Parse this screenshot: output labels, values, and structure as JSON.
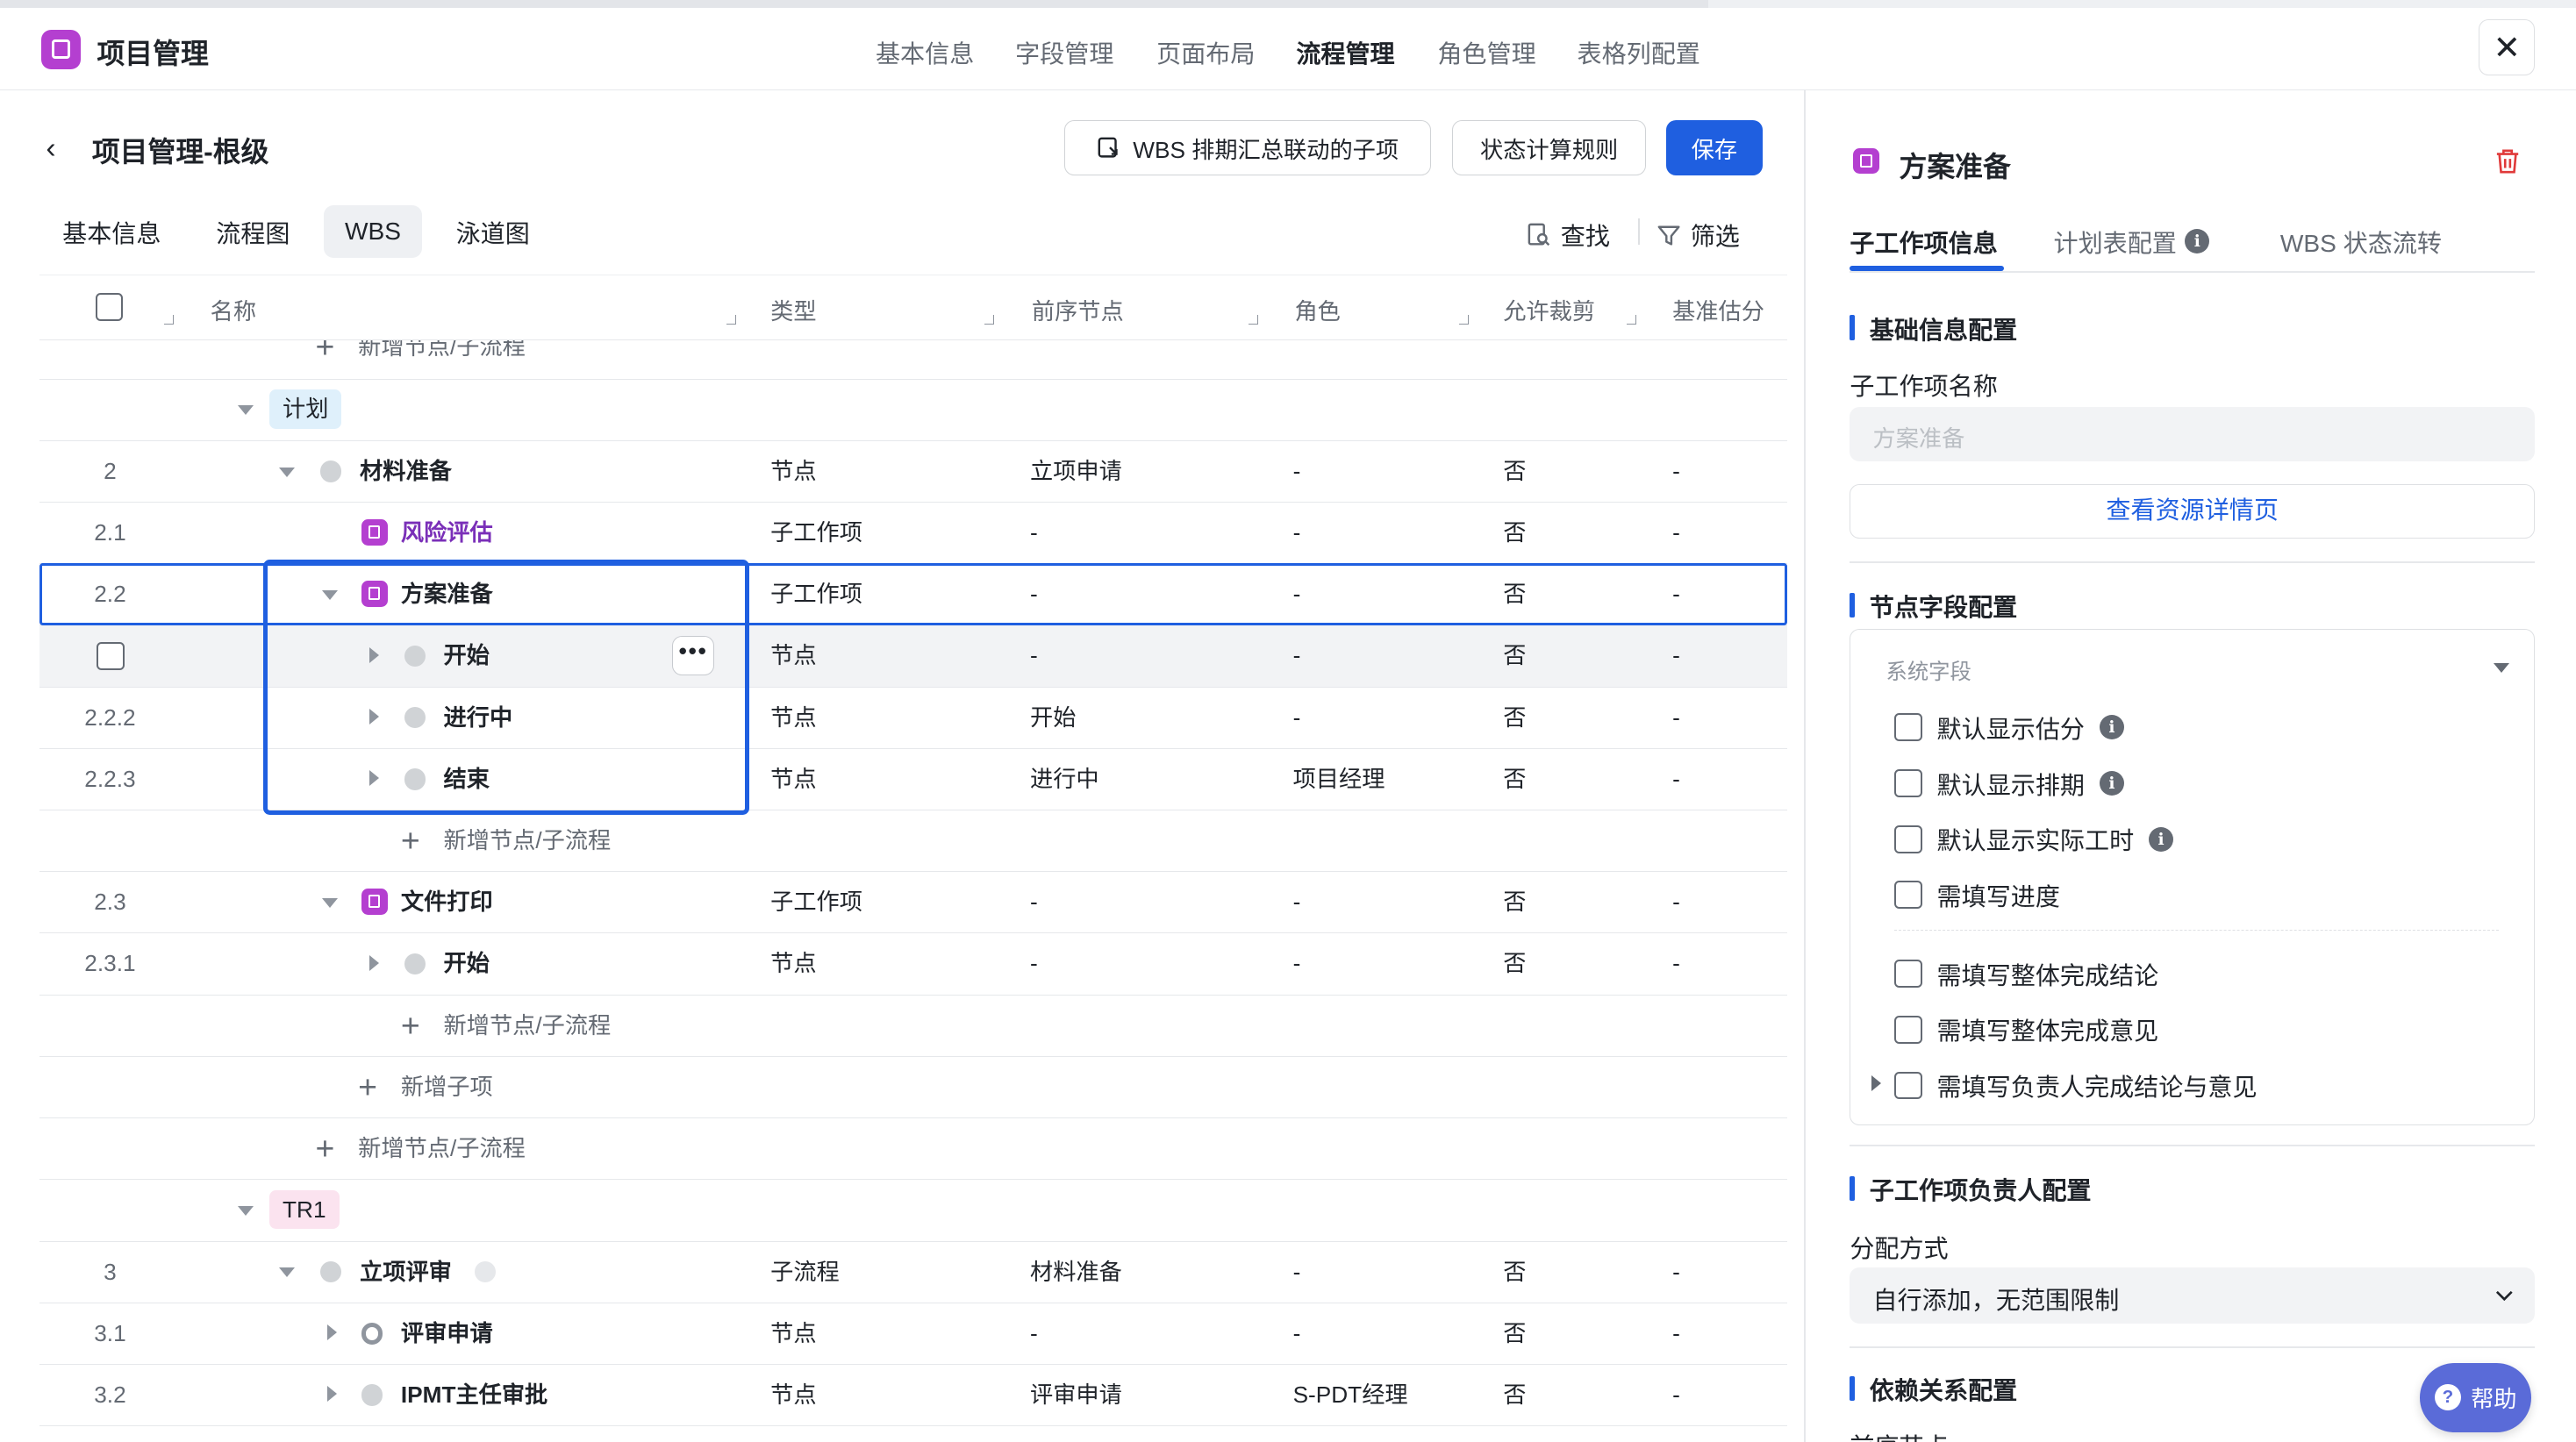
{
  "app": {
    "title": "项目管理",
    "nav": [
      "基本信息",
      "字段管理",
      "页面布局",
      "流程管理",
      "角色管理",
      "表格列配置"
    ],
    "active_nav": "流程管理",
    "close": "✕"
  },
  "subheader": {
    "back": "‹",
    "title": "项目管理-根级",
    "buttons": {
      "wbs_link": "WBS 排期汇总联动的子项",
      "status_rules": "状态计算规则",
      "save": "保存"
    }
  },
  "view_tabs": [
    "基本信息",
    "流程图",
    "WBS",
    "泳道图"
  ],
  "active_view_tab": "WBS",
  "toolbar": {
    "find": "查找",
    "filter": "筛选"
  },
  "table": {
    "columns": [
      "名称",
      "类型",
      "前序节点",
      "角色",
      "允许裁剪",
      "基准估分"
    ],
    "partial_add": "新增节点/子流程",
    "group_plan": "计划",
    "group_tr1": "TR1",
    "rows": [
      {
        "num": "2",
        "name": "材料准备",
        "type": "节点",
        "prev": "立项申请",
        "role": "-",
        "cut": "否",
        "est": "-"
      },
      {
        "num": "2.1",
        "name": "风险评估",
        "type": "子工作项",
        "prev": "-",
        "role": "-",
        "cut": "否",
        "est": "-"
      },
      {
        "num": "2.2",
        "name": "方案准备",
        "type": "子工作项",
        "prev": "-",
        "role": "-",
        "cut": "否",
        "est": "-"
      },
      {
        "num": "",
        "name": "开始",
        "type": "节点",
        "prev": "-",
        "role": "-",
        "cut": "否",
        "est": "-"
      },
      {
        "num": "2.2.2",
        "name": "进行中",
        "type": "节点",
        "prev": "开始",
        "role": "-",
        "cut": "否",
        "est": "-"
      },
      {
        "num": "2.2.3",
        "name": "结束",
        "type": "节点",
        "prev": "进行中",
        "role": "项目经理",
        "cut": "否",
        "est": "-"
      },
      {
        "num": "2.3",
        "name": "文件打印",
        "type": "子工作项",
        "prev": "-",
        "role": "-",
        "cut": "否",
        "est": "-"
      },
      {
        "num": "2.3.1",
        "name": "开始",
        "type": "节点",
        "prev": "-",
        "role": "-",
        "cut": "否",
        "est": "-"
      },
      {
        "num": "3",
        "name": "立项评审",
        "type": "子流程",
        "prev": "材料准备",
        "role": "-",
        "cut": "否",
        "est": "-"
      },
      {
        "num": "3.1",
        "name": "评审申请",
        "type": "节点",
        "prev": "-",
        "role": "-",
        "cut": "否",
        "est": "-"
      },
      {
        "num": "3.2",
        "name": "IPMT主任审批",
        "type": "节点",
        "prev": "评审申请",
        "role": "S-PDT经理",
        "cut": "否",
        "est": "-"
      }
    ],
    "add_node": "新增节点/子流程",
    "add_child": "新增子项",
    "more": "•••"
  },
  "panel": {
    "title": "方案准备",
    "tabs": [
      "子工作项信息",
      "计划表配置",
      "WBS 状态流转"
    ],
    "active_tab": "子工作项信息",
    "basic_section": "基础信息配置",
    "name_label": "子工作项名称",
    "name_placeholder": "方案准备",
    "view_resource": "查看资源详情页",
    "node_section": "节点字段配置",
    "system_fields": "系统字段",
    "checks": [
      "默认显示估分",
      "默认显示排期",
      "默认显示实际工时",
      "需填写进度",
      "需填写整体完成结论",
      "需填写整体完成意见",
      "需填写负责人完成结论与意见"
    ],
    "owner_section": "子工作项负责人配置",
    "assign_label": "分配方式",
    "assign_value": "自行添加，无范围限制",
    "dep_section": "依赖关系配置",
    "dep_label": "前序节点"
  },
  "help": {
    "label": "帮助",
    "icon": "?"
  },
  "colors": {
    "primary": "#1f5fe0",
    "subitem": "#b43fd0",
    "highlight_border": "#1f5fe0"
  }
}
